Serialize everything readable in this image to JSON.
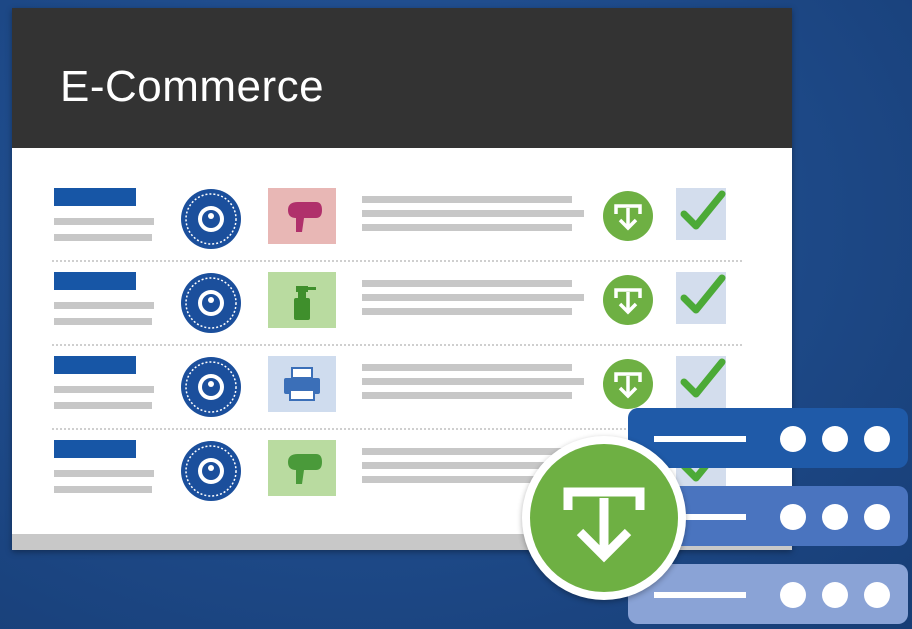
{
  "header": {
    "title": "E-Commerce"
  },
  "colors": {
    "header_bg": "#333333",
    "accent_blue": "#1756a6",
    "green": "#6eb043",
    "check_green": "#4caa37",
    "server_dark": "#1f5aa8",
    "server_mid": "#4a74bf",
    "server_light": "#8aa3d6"
  },
  "rows": [
    {
      "product": "hair-dryer-icon",
      "thumb_color": "#e8b7b5",
      "product_color": "#b0306b"
    },
    {
      "product": "spray-bottle-icon",
      "thumb_color": "#b9dba0",
      "product_color": "#3f8f2c"
    },
    {
      "product": "printer-icon",
      "thumb_color": "#cfdcee",
      "product_color": "#3b6fb8"
    },
    {
      "product": "hair-dryer-icon",
      "thumb_color": "#b9dba0",
      "product_color": "#4a9a3a"
    }
  ],
  "icons": {
    "eco_badge": "eco-label-badge-icon",
    "row_download": "download-circle-icon",
    "row_check": "checkmark-icon",
    "big_download": "download-circle-icon",
    "servers": "server-stack-icon"
  }
}
